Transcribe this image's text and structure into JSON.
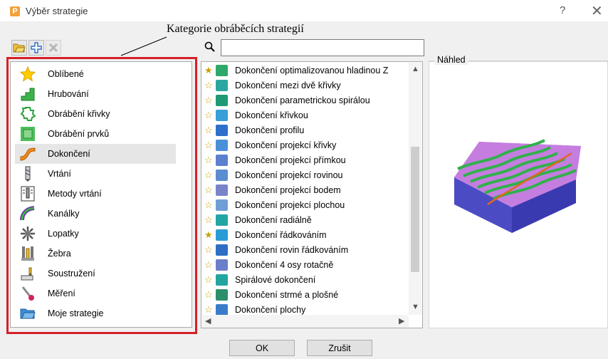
{
  "window": {
    "title": "Výběr strategie",
    "help": "?",
    "close": "✕",
    "app_icon_letter": "P"
  },
  "annotation": "Kategorie obráběcích strategií",
  "search": {
    "value": "",
    "placeholder": ""
  },
  "categories": [
    {
      "label": "Oblíbené",
      "icon": "star-icon",
      "selected": false
    },
    {
      "label": "Hrubování",
      "icon": "roughing-icon",
      "selected": false
    },
    {
      "label": "Obrábění křivky",
      "icon": "curve-machining-icon",
      "selected": false
    },
    {
      "label": "Obrábění prvků",
      "icon": "feature-machining-icon",
      "selected": false
    },
    {
      "label": "Dokončení",
      "icon": "finishing-icon",
      "selected": true
    },
    {
      "label": "Vrtání",
      "icon": "drilling-icon",
      "selected": false
    },
    {
      "label": "Metody vrtání",
      "icon": "drilling-methods-icon",
      "selected": false
    },
    {
      "label": "Kanálky",
      "icon": "ports-icon",
      "selected": false
    },
    {
      "label": "Lopatky",
      "icon": "blades-icon",
      "selected": false
    },
    {
      "label": "Žebra",
      "icon": "ribs-icon",
      "selected": false
    },
    {
      "label": "Soustružení",
      "icon": "turning-icon",
      "selected": false
    },
    {
      "label": "Měření",
      "icon": "probing-icon",
      "selected": false
    },
    {
      "label": "Moje strategie",
      "icon": "folder-icon",
      "selected": false
    }
  ],
  "strategies": [
    {
      "label": "Dokončení optimalizovanou hladinou Z",
      "favorite": true,
      "color": "#2fa86b"
    },
    {
      "label": "Dokončení mezi dvě křivky",
      "favorite": false,
      "color": "#2aa7a0"
    },
    {
      "label": "Dokončení parametrickou spirálou",
      "favorite": false,
      "color": "#1f9a74"
    },
    {
      "label": "Dokončení křivkou",
      "favorite": false,
      "color": "#3a9ed8"
    },
    {
      "label": "Dokončení profilu",
      "favorite": false,
      "color": "#2f6fc9"
    },
    {
      "label": "Dokončení projekcí křivky",
      "favorite": false,
      "color": "#4a90d9"
    },
    {
      "label": "Dokončení projekcí přímkou",
      "favorite": false,
      "color": "#5d7fcf"
    },
    {
      "label": "Dokončení projekcí rovinou",
      "favorite": false,
      "color": "#5b8cd0"
    },
    {
      "label": "Dokončení projekcí bodem",
      "favorite": false,
      "color": "#7a84c8"
    },
    {
      "label": "Dokončení projekcí plochou",
      "favorite": false,
      "color": "#6f9fd6"
    },
    {
      "label": "Dokončení radiálně",
      "favorite": false,
      "color": "#22a5a5"
    },
    {
      "label": "Dokončení řádkováním",
      "favorite": true,
      "color": "#2b9bd6"
    },
    {
      "label": "Dokončení rovin řádkováním",
      "favorite": false,
      "color": "#2e6fc4"
    },
    {
      "label": "Dokončení 4 osy rotačně",
      "favorite": false,
      "color": "#6a7ec9"
    },
    {
      "label": "Spirálové dokončení",
      "favorite": false,
      "color": "#23a6a0"
    },
    {
      "label": "Dokončení strmé a plošné",
      "favorite": false,
      "color": "#2d8f6a"
    },
    {
      "label": "Dokončení plochy",
      "favorite": false,
      "color": "#3b7cc8"
    }
  ],
  "preview": {
    "label": "Náhled"
  },
  "buttons": {
    "ok": "OK",
    "cancel": "Zrušit"
  }
}
